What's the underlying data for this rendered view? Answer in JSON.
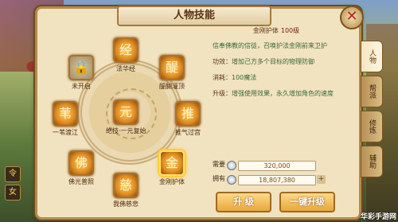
{
  "window": {
    "title": "人物技能",
    "close_glyph": "✕"
  },
  "skill_wheel": {
    "skills": [
      {
        "name": "法华经",
        "glyph": "经",
        "state": "normal",
        "badge": ""
      },
      {
        "name": "未开启",
        "glyph": "🔒",
        "state": "locked",
        "badge": ""
      },
      {
        "name": "醍醐灌顶",
        "glyph": "醍",
        "state": "normal",
        "badge": ""
      },
      {
        "name": "一苇渡江",
        "glyph": "苇",
        "state": "normal",
        "badge": ""
      },
      {
        "name": "绝技·一元复始",
        "glyph": "元",
        "state": "normal",
        "badge": ""
      },
      {
        "name": "推气过宫",
        "glyph": "推",
        "state": "normal",
        "badge": ""
      },
      {
        "name": "佛光普照",
        "glyph": "佛",
        "state": "normal",
        "badge": ""
      },
      {
        "name": "金刚护体",
        "glyph": "金",
        "state": "selected",
        "badge": ""
      },
      {
        "name": "我佛慈悲",
        "glyph": "慈",
        "state": "normal",
        "badge": ""
      }
    ]
  },
  "detail": {
    "skill_name": "金刚护体",
    "skill_level": "100级",
    "description": "信奉佛教的信徒，召唤护法金刚前来卫护",
    "effect_label": "功效：",
    "effect_text": "增加己方多个目标的物理防御",
    "cost_label": "消耗：",
    "cost_text": "100魔法",
    "upgrade_label": "升级：",
    "upgrade_text": "增强使用效果，永久增加角色的速度",
    "required_label": "需要",
    "required_value": "320,000",
    "owned_label": "拥有",
    "owned_value": "18,807,380",
    "plus_glyph": "+",
    "upgrade_button": "升 级",
    "one_click_button": "一键升级"
  },
  "tabs": [
    {
      "label": "人物",
      "active": true
    },
    {
      "label": "帮派",
      "active": false
    },
    {
      "label": "修炼",
      "active": false
    },
    {
      "label": "辅助",
      "active": false
    }
  ],
  "hud": {
    "icons": [
      "令",
      "女"
    ]
  },
  "watermark": "华彩手游网"
}
